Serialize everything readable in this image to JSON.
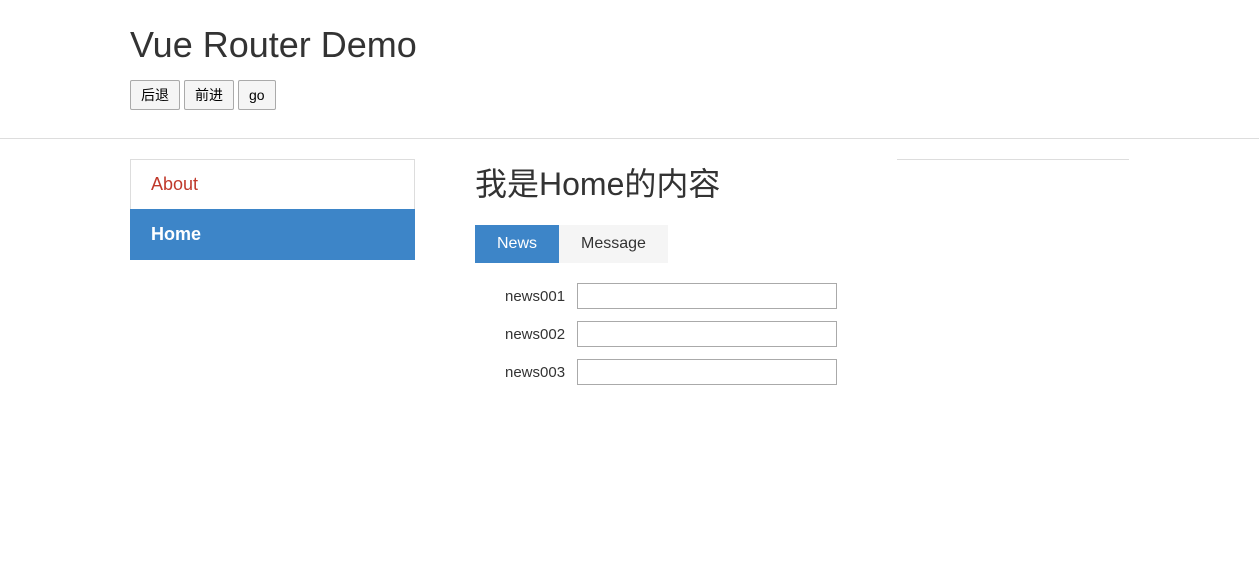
{
  "header": {
    "title": "Vue Router Demo",
    "buttons": {
      "back": "后退",
      "forward": "前进",
      "go": "go"
    }
  },
  "sidebar": {
    "items": [
      {
        "label": "About",
        "active": false
      },
      {
        "label": "Home",
        "active": true
      }
    ]
  },
  "content": {
    "title": "我是Home的内容",
    "tabs": [
      {
        "label": "News",
        "active": true
      },
      {
        "label": "Message",
        "active": false
      }
    ],
    "newsList": [
      {
        "label": "news001"
      },
      {
        "label": "news002"
      },
      {
        "label": "news003"
      }
    ]
  }
}
